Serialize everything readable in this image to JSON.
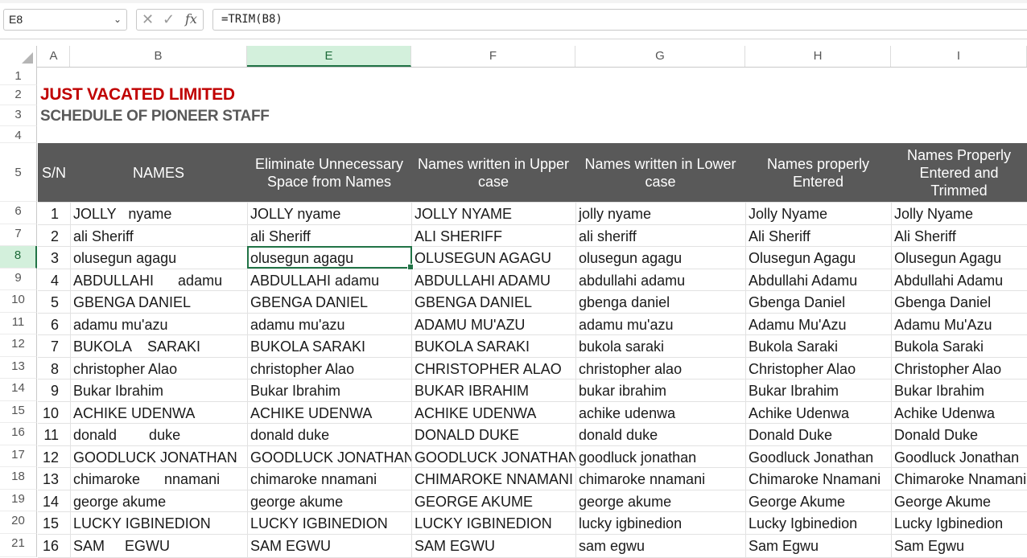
{
  "formula_bar": {
    "name_box": "E8",
    "formula": "=TRIM(B8)",
    "cancel_icon": "✕",
    "confirm_icon": "✓",
    "fx_label": "fx"
  },
  "columns": [
    "A",
    "B",
    "E",
    "F",
    "G",
    "H",
    "I"
  ],
  "rows": [
    "1",
    "2",
    "3",
    "4",
    "5",
    "6",
    "7",
    "8",
    "9",
    "10",
    "11",
    "12",
    "13",
    "14",
    "15",
    "16",
    "17",
    "18",
    "19",
    "20",
    "21"
  ],
  "selected": {
    "column": "E",
    "row": "8"
  },
  "titles": {
    "company": "JUST VACATED LIMITED",
    "schedule": "SCHEDULE OF PIONEER STAFF"
  },
  "table": {
    "headers": [
      "S/N",
      "NAMES",
      "Eliminate Unnecessary\nSpace from Names",
      "Names written in Upper\ncase",
      "Names written in Lower\ncase",
      "Names properly\nEntered",
      "Names Properly\nEntered and\nTrimmed"
    ],
    "rows": [
      [
        "1",
        "JOLLY   nyame",
        "JOLLY nyame",
        "JOLLY NYAME",
        "jolly nyame",
        "Jolly Nyame",
        "Jolly Nyame"
      ],
      [
        "2",
        "ali Sheriff",
        "ali Sheriff",
        "ALI SHERIFF",
        "ali sheriff",
        "Ali Sheriff",
        "Ali Sheriff"
      ],
      [
        "3",
        "olusegun agagu",
        "olusegun agagu",
        "OLUSEGUN AGAGU",
        "olusegun agagu",
        "Olusegun Agagu",
        "Olusegun Agagu"
      ],
      [
        "4",
        "ABDULLAHI      adamu",
        "ABDULLAHI adamu",
        "ABDULLAHI ADAMU",
        "abdullahi adamu",
        "Abdullahi Adamu",
        "Abdullahi Adamu"
      ],
      [
        "5",
        "GBENGA DANIEL",
        "GBENGA DANIEL",
        "GBENGA DANIEL",
        "gbenga daniel",
        "Gbenga Daniel",
        "Gbenga Daniel"
      ],
      [
        "6",
        "adamu mu'azu",
        "adamu mu'azu",
        "ADAMU MU'AZU",
        "adamu mu'azu",
        "Adamu Mu'Azu",
        "Adamu Mu'Azu"
      ],
      [
        "7",
        "BUKOLA    SARAKI",
        "BUKOLA SARAKI",
        "BUKOLA SARAKI",
        "bukola saraki",
        "Bukola Saraki",
        "Bukola Saraki"
      ],
      [
        "8",
        "christopher Alao",
        "christopher Alao",
        "CHRISTOPHER ALAO",
        "christopher alao",
        "Christopher Alao",
        "Christopher Alao"
      ],
      [
        "9",
        "Bukar Ibrahim",
        "Bukar Ibrahim",
        "BUKAR IBRAHIM",
        "bukar ibrahim",
        "Bukar Ibrahim",
        "Bukar Ibrahim"
      ],
      [
        "10",
        "ACHIKE UDENWA",
        "ACHIKE UDENWA",
        "ACHIKE UDENWA",
        "achike udenwa",
        "Achike Udenwa",
        "Achike Udenwa"
      ],
      [
        "11",
        "donald        duke",
        "donald duke",
        "DONALD DUKE",
        "donald duke",
        "Donald Duke",
        "Donald Duke"
      ],
      [
        "12",
        "GOODLUCK JONATHAN",
        "GOODLUCK JONATHAN",
        "GOODLUCK JONATHAN",
        "goodluck jonathan",
        "Goodluck Jonathan",
        "Goodluck Jonathan"
      ],
      [
        "13",
        "chimaroke      nnamani",
        "chimaroke nnamani",
        "CHIMAROKE NNAMANI",
        "chimaroke nnamani",
        "Chimaroke Nnamani",
        "Chimaroke Nnamani"
      ],
      [
        "14",
        "george akume",
        "george akume",
        "GEORGE AKUME",
        "george akume",
        "George Akume",
        "George Akume"
      ],
      [
        "15",
        "LUCKY IGBINEDION",
        "LUCKY IGBINEDION",
        "LUCKY IGBINEDION",
        "lucky igbinedion",
        "Lucky Igbinedion",
        "Lucky Igbinedion"
      ],
      [
        "16",
        "SAM     EGWU",
        "SAM EGWU",
        "SAM EGWU",
        "sam egwu",
        "Sam Egwu",
        "Sam Egwu"
      ]
    ]
  }
}
